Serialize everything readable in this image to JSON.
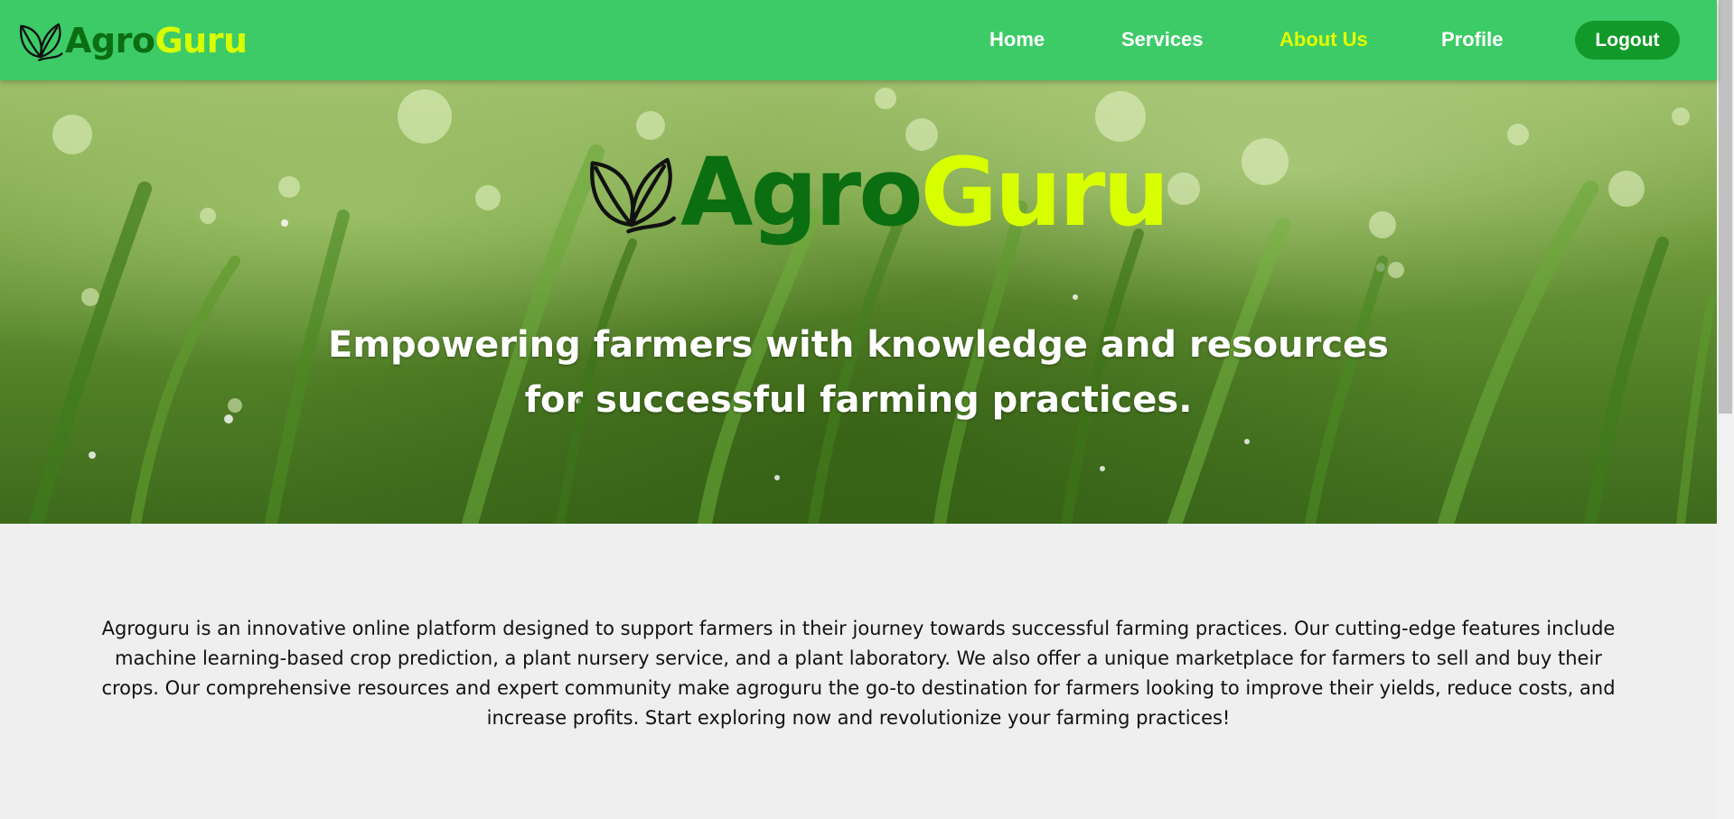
{
  "navbar": {
    "brand": {
      "agro": "Agro",
      "guru": "Guru"
    },
    "links": [
      {
        "label": "Home"
      },
      {
        "label": "Services"
      },
      {
        "label": "About Us"
      },
      {
        "label": "Profile"
      }
    ],
    "active_link": "About Us",
    "logout_label": "Logout"
  },
  "hero": {
    "logo": {
      "agro": "Agro",
      "guru": "Guru"
    },
    "tagline": "Empowering farmers with knowledge and resources for successful farming practices."
  },
  "about": {
    "text": "Agroguru is an innovative online platform designed to support farmers in their journey towards successful farming practices. Our cutting-edge features include machine learning-based crop prediction, a plant nursery service, and a plant laboratory. We also offer a unique marketplace for farmers to sell and buy their crops. Our comprehensive resources and expert community make agroguru the go-to destination for farmers looking to improve their yields, reduce costs, and increase profits. Start exploring now and revolutionize your farming practices!"
  },
  "colors": {
    "navbar_bg": "#3ccb67",
    "agro": "#0b6e11",
    "guru": "#d8ff00",
    "active_link": "#e3ff00",
    "logout_bg": "#119a2a"
  },
  "icons": {
    "brand_logo": "leaves-icon"
  }
}
